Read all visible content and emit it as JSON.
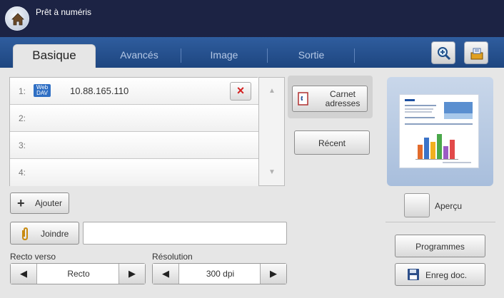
{
  "header": {
    "title": "Prêt à numéris"
  },
  "tabs": [
    {
      "label": "Basique",
      "active": true
    },
    {
      "label": "Avancés",
      "active": false
    },
    {
      "label": "Image",
      "active": false
    },
    {
      "label": "Sortie",
      "active": false
    }
  ],
  "toolbar_icons": [
    "zoom-in-icon",
    "job-status-icon"
  ],
  "destinations": [
    {
      "num": "1:",
      "badge": "Web DAV",
      "address": "10.88.165.110"
    },
    {
      "num": "2:",
      "badge": "",
      "address": ""
    },
    {
      "num": "3:",
      "badge": "",
      "address": ""
    },
    {
      "num": "4:",
      "badge": "",
      "address": ""
    }
  ],
  "delete_label": "×",
  "buttons": {
    "carnet_line1": "Carnet",
    "carnet_line2": "adresses",
    "recent": "Récent",
    "ajouter": "Ajouter",
    "joindre": "Joindre",
    "apercu": "Aperçu",
    "programmes": "Programmes",
    "enreg": "Enreg doc."
  },
  "attach_value": "",
  "recto_verso": {
    "label": "Recto verso",
    "value": "Recto"
  },
  "resolution": {
    "label": "Résolution",
    "value": "300 dpi"
  },
  "colors": {
    "header_bg": "#1c2344",
    "tab_bg": "#2f5d9e",
    "content_bg": "#e6e6e6",
    "preview_bg": "#b8cbe4",
    "delete_x": "#d42020"
  }
}
